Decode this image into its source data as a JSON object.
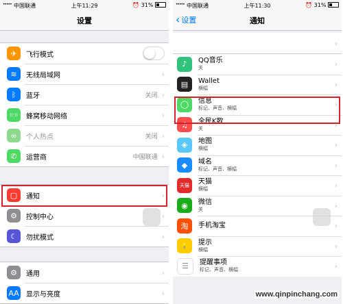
{
  "left": {
    "status": {
      "signal": "•••••",
      "carrier": "中国联通",
      "time": "上午11:29",
      "battery": "31%"
    },
    "nav_title": "设置",
    "group1": [
      {
        "icon": "airplane-icon",
        "glyph": "✈",
        "color": "#ff9500",
        "label": "飞行模式",
        "type": "toggle"
      },
      {
        "icon": "wifi-icon",
        "glyph": "≋",
        "color": "#007aff",
        "label": "无线局域网",
        "type": "plain"
      },
      {
        "icon": "bluetooth-icon",
        "glyph": "ᛒ",
        "color": "#007aff",
        "label": "蓝牙",
        "value": "关闭",
        "type": "value"
      },
      {
        "icon": "cellular-icon",
        "glyph": "((·))",
        "color": "#4cd964",
        "label": "蜂窝移动网络",
        "type": "plain"
      },
      {
        "icon": "hotspot-icon",
        "glyph": "∞",
        "color": "#8fd98f",
        "label": "个人热点",
        "value": "关闭",
        "type": "value",
        "disabled": true
      },
      {
        "icon": "phone-icon",
        "glyph": "✆",
        "color": "#4cd964",
        "label": "运营商",
        "value": "中国联通",
        "type": "value"
      }
    ],
    "group2": [
      {
        "icon": "notification-icon",
        "glyph": "▢",
        "color": "#ff3b30",
        "label": "通知",
        "type": "plain"
      },
      {
        "icon": "control-center-icon",
        "glyph": "⚙",
        "color": "#8e8e93",
        "label": "控制中心",
        "type": "plain"
      },
      {
        "icon": "moon-icon",
        "glyph": "☾",
        "color": "#5856d6",
        "label": "勿扰模式",
        "type": "plain"
      }
    ],
    "group3": [
      {
        "icon": "gear-icon",
        "glyph": "⚙",
        "color": "#8e8e93",
        "label": "通用",
        "type": "plain"
      },
      {
        "icon": "display-icon",
        "glyph": "AA",
        "color": "#007aff",
        "label": "显示与亮度",
        "type": "plain"
      }
    ]
  },
  "right": {
    "status": {
      "signal": "•••••",
      "carrier": "中国联通",
      "time": "上午11:30",
      "battery": "31%"
    },
    "nav_back": "设置",
    "nav_title": "通知",
    "apps": [
      {
        "icon": "qq-music-icon",
        "glyph": "♪",
        "color": "#31c27c",
        "name": "QQ音乐",
        "sub": "关"
      },
      {
        "icon": "wallet-icon",
        "glyph": "▤",
        "color": "#222222",
        "name": "Wallet",
        "sub": "横幅"
      },
      {
        "icon": "messages-icon",
        "glyph": "◯",
        "color": "#4cd964",
        "name": "信息",
        "sub": "标记、声音、横幅"
      },
      {
        "icon": "kge-icon",
        "glyph": "♫",
        "color": "#ff4d4d",
        "name": "全民K歌",
        "sub": "关"
      },
      {
        "icon": "maps-icon",
        "glyph": "◈",
        "color": "#5ac8fa",
        "name": "地图",
        "sub": "横幅"
      },
      {
        "icon": "domain-icon",
        "glyph": "◆",
        "color": "#1a8cff",
        "name": "域名",
        "sub": "标记、声音、横幅"
      },
      {
        "icon": "tmall-icon",
        "glyph": "天猫",
        "color": "#e22b2b",
        "name": "天猫",
        "sub": "横幅"
      },
      {
        "icon": "wechat-icon",
        "glyph": "◉",
        "color": "#1aad19",
        "name": "微信",
        "sub": "关"
      },
      {
        "icon": "taobao-icon",
        "glyph": "淘",
        "color": "#ff5000",
        "name": "手机淘宝",
        "sub": ""
      },
      {
        "icon": "tips-icon",
        "glyph": "💡",
        "color": "#ffcc00",
        "name": "提示",
        "sub": "横幅"
      },
      {
        "icon": "reminders-icon",
        "glyph": "☰",
        "color": "#ffffff",
        "name": "提醒事项",
        "sub": "标记、声音、横幅"
      }
    ]
  },
  "watermark": "www.qinpinchang.com"
}
